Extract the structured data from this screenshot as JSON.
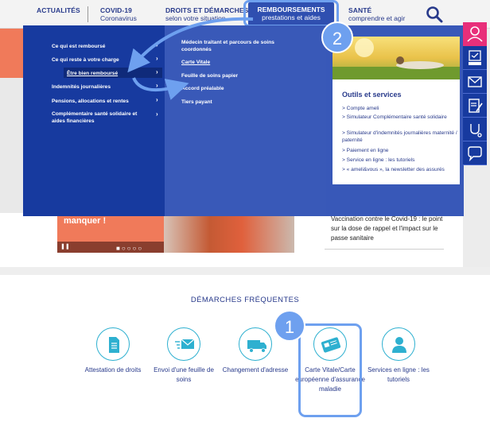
{
  "nav": {
    "actualites": "ACTUALITÉS",
    "covid_l1": "COVID-19",
    "covid_l2": "Coronavirus",
    "demarches_l1": "DROITS ET DÉMARCHES",
    "demarches_l2": "selon votre situation",
    "remboursements_l1": "REMBOURSEMENTS",
    "remboursements_l2": "prestations et aides",
    "sante_l1": "SANTÉ",
    "sante_l2": "comprendre et agir",
    "search_icon": "search-icon"
  },
  "menu": {
    "items": [
      "Ce qui est remboursé",
      "Ce qui reste à votre charge",
      "Être bien remboursé",
      "Indemnités journalières",
      "Pensions, allocations et rentes",
      "Complémentaire santé solidaire et aides financières"
    ],
    "selected_index": 2,
    "sub_items": [
      "Médecin traitant et parcours de soins coordonnés",
      "Carte Vitale",
      "Feuille de soins papier",
      "Accord préalable",
      "Tiers payant"
    ]
  },
  "tools": {
    "title": "Outils et services",
    "links": [
      "> Compte ameli",
      "> Simulateur Complémentaire santé solidaire",
      "> Simulateur d'indemnités journalières maternité / paternité",
      "> Paiement en ligne",
      "> Service en ligne : les tutoriels",
      "> « ameli&vous », la newsletter des assurés"
    ]
  },
  "background": {
    "banner_text": "manquer !",
    "news_text": "Vaccination contre le Covid-19 : le point sur la dose de rappel et l'impact sur le passe sanitaire"
  },
  "frequent": {
    "title": "DÉMARCHES FRÉQUENTES",
    "items": [
      {
        "label": "Attestation de droits",
        "icon": "document-icon"
      },
      {
        "label": "Envoi d'une feuille de soins",
        "icon": "mail-send-icon"
      },
      {
        "label": "Changement d'adresse",
        "icon": "moving-truck-icon"
      },
      {
        "label": "Carte Vitale/Carte européenne d'assurance maladie",
        "icon": "card-icon"
      },
      {
        "label": "Services en ligne : les tutoriels",
        "icon": "user-icon"
      }
    ]
  },
  "side_icons": [
    "account-icon",
    "dmp-icon",
    "messaging-icon",
    "form-icon",
    "health-icon",
    "chat-icon"
  ],
  "badges": {
    "one": "1",
    "two": "2"
  },
  "colors": {
    "primary": "#173a9f",
    "accent": "#2eb0d0",
    "highlight": "#6ea0ef",
    "pink": "#e82f7a"
  }
}
